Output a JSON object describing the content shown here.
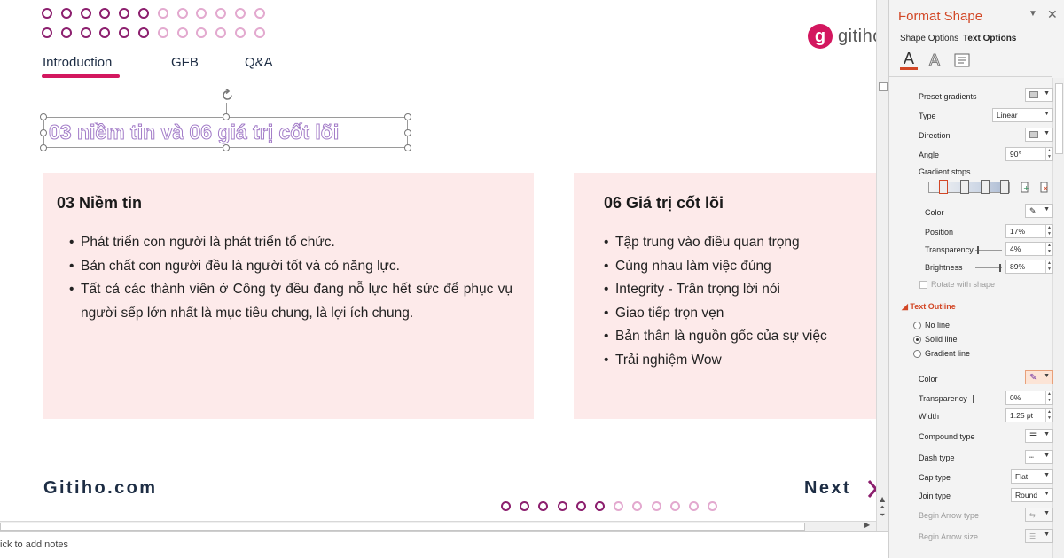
{
  "slide": {
    "nav": [
      "Introduction",
      "GFB",
      "Q&A"
    ],
    "logo_text": "gitiho",
    "logo_mark": "g",
    "title": "03 niềm tin và 06 giá trị cốt lõi",
    "card_left": {
      "heading": "03 Niềm tin",
      "items": [
        "Phát triển con người là phát triển tổ chức.",
        "Bản chất con người đều là người tốt và có năng lực.",
        "Tất cả các thành viên ở Công ty đều đang nỗ lực hết sức để phục vụ người sếp lớn nhất là mục tiêu chung, là lợi ích chung."
      ]
    },
    "card_right": {
      "heading": "06 Giá trị cốt lõi",
      "items": [
        "Tập trung vào điều quan trọng",
        "Cùng nhau làm việc đúng",
        "Integrity - Trân trọng lời nói",
        "Giao tiếp trọn vẹn",
        "Bản thân là nguồn gốc của sự việc",
        "Trải nghiệm Wow"
      ]
    },
    "footer_brand": "Gitiho.com",
    "next_label": "Next",
    "accent_color": "#d3175f",
    "dot_color": "#8c1f6e"
  },
  "notes": {
    "placeholder": "ick to add notes"
  },
  "pane": {
    "title": "Format Shape",
    "tabs": [
      "Shape Options",
      "Text Options"
    ],
    "icons": [
      "text-fill-icon",
      "text-effects-icon",
      "textbox-icon"
    ],
    "fill": {
      "preset_gradients": "Preset gradients",
      "type_label": "Type",
      "type_value": "Linear",
      "direction_label": "Direction",
      "angle_label": "Angle",
      "angle_value": "90°",
      "gradient_stops_label": "Gradient stops",
      "color_label": "Color",
      "position_label": "Position",
      "position_value": "17%",
      "transparency_label": "Transparency",
      "transparency_value": "4%",
      "brightness_label": "Brightness",
      "brightness_value": "89%",
      "rotate_label": "Rotate with shape"
    },
    "outline": {
      "section": "Text Outline",
      "no_line": "No line",
      "solid_line": "Solid line",
      "gradient_line": "Gradient line",
      "color_label": "Color",
      "transparency_label": "Transparency",
      "transparency_value": "0%",
      "width_label": "Width",
      "width_value": "1.25 pt",
      "compound_label": "Compound type",
      "dash_label": "Dash type",
      "cap_label": "Cap type",
      "cap_value": "Flat",
      "join_label": "Join type",
      "join_value": "Round",
      "begin_arrow_type": "Begin Arrow type",
      "begin_arrow_size": "Begin Arrow size"
    }
  }
}
